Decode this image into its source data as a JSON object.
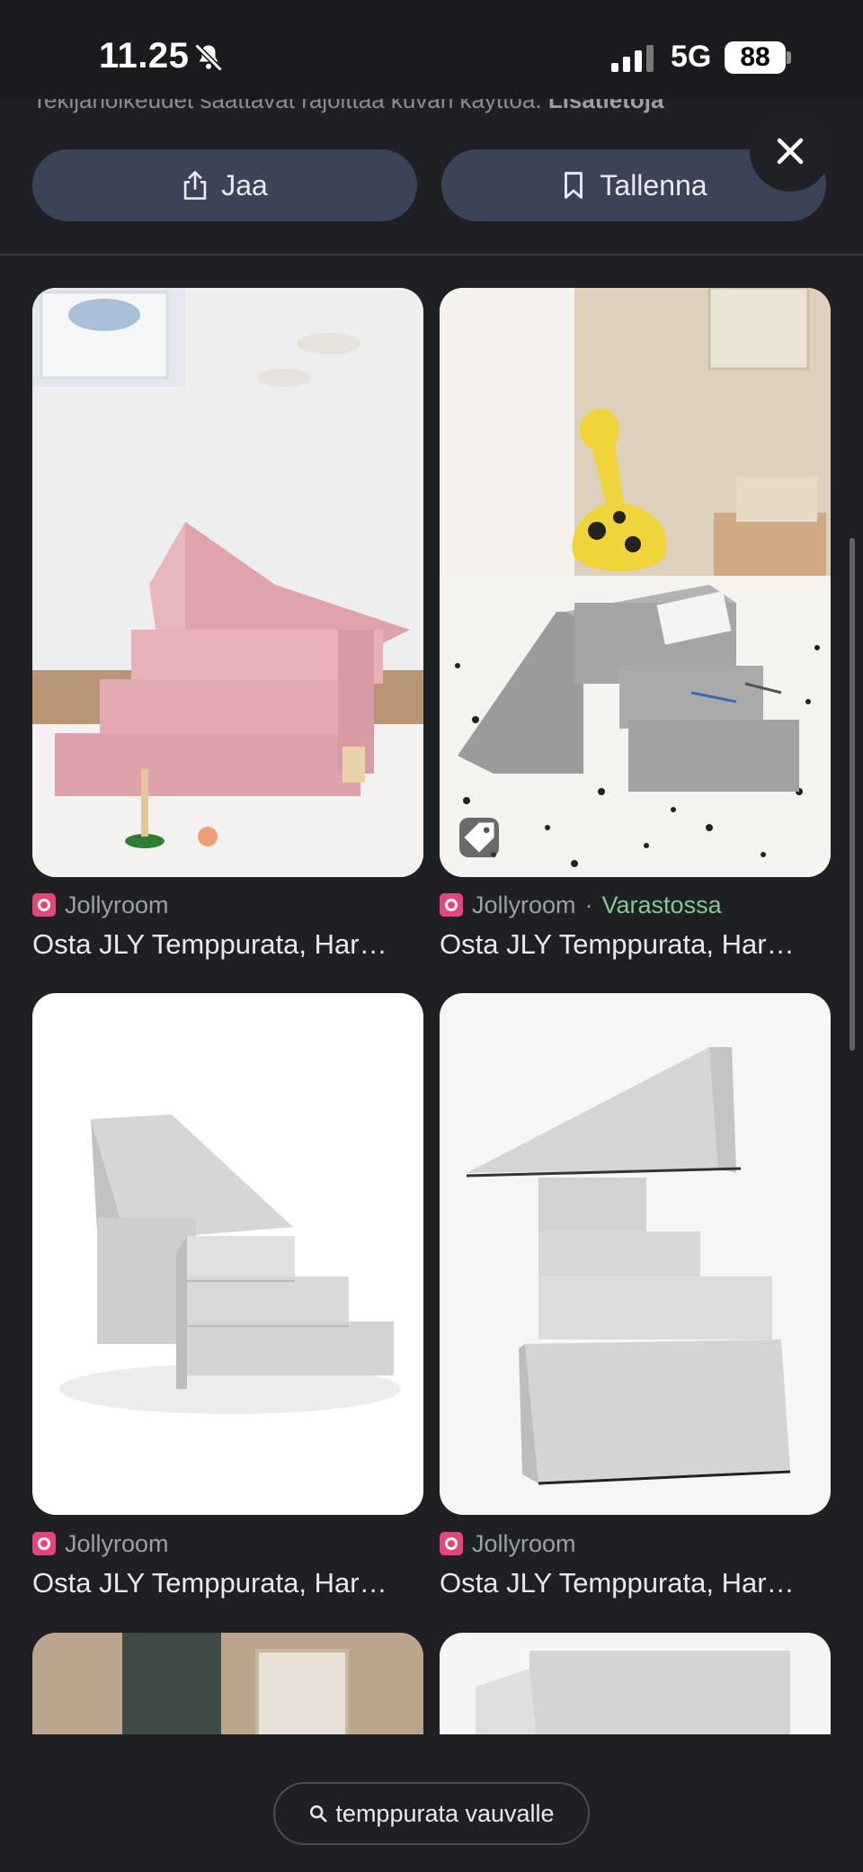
{
  "status_bar": {
    "time": "11.25",
    "network": "5G",
    "battery": "88"
  },
  "attribution": {
    "text": "Tekijänoikeudet saattavat rajoittaa kuvan käyttöä.",
    "link": "Lisätietoja"
  },
  "actions": {
    "share_label": "Jaa",
    "save_label": "Tallenna"
  },
  "results": [
    {
      "source": "Jollyroom",
      "stock": "",
      "title": "Osta JLY Temppurata, Har…"
    },
    {
      "source": "Jollyroom",
      "separator": "·",
      "stock": "Varastossa",
      "title": "Osta JLY Temppurata, Har…"
    },
    {
      "source": "Jollyroom",
      "stock": "",
      "title": "Osta JLY Temppurata, Har…"
    },
    {
      "source": "Jollyroom",
      "stock": "",
      "title": "Osta JLY Temppurata, Har…"
    }
  ],
  "search": {
    "query": "temppurata vauvalle"
  },
  "colors": {
    "background": "#1f2023",
    "button": "#3b4456",
    "stock": "#81c995",
    "brand": "#e6457a"
  }
}
